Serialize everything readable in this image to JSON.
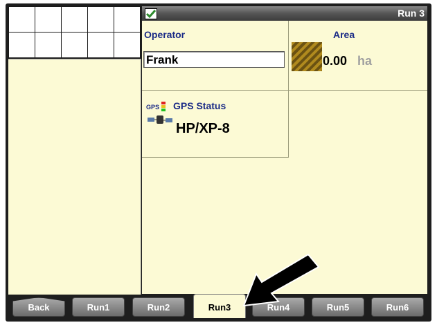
{
  "header": {
    "title": "Run 3"
  },
  "operator": {
    "label": "Operator",
    "value": "Frank"
  },
  "area": {
    "label": "Area",
    "value": "0.00",
    "unit": "ha"
  },
  "gps": {
    "small_label": "GPS",
    "label": "GPS Status",
    "value": "HP/XP-8"
  },
  "tabs": [
    {
      "label": "Back"
    },
    {
      "label": "Run1"
    },
    {
      "label": "Run2"
    },
    {
      "label": "Run3"
    },
    {
      "label": "Run4"
    },
    {
      "label": "Run5"
    },
    {
      "label": "Run6"
    }
  ],
  "active_tab": "Run3",
  "colors": {
    "panel": "#fcfad5",
    "label_blue": "#1a2a86",
    "area_swatch": "#b08a1e"
  }
}
